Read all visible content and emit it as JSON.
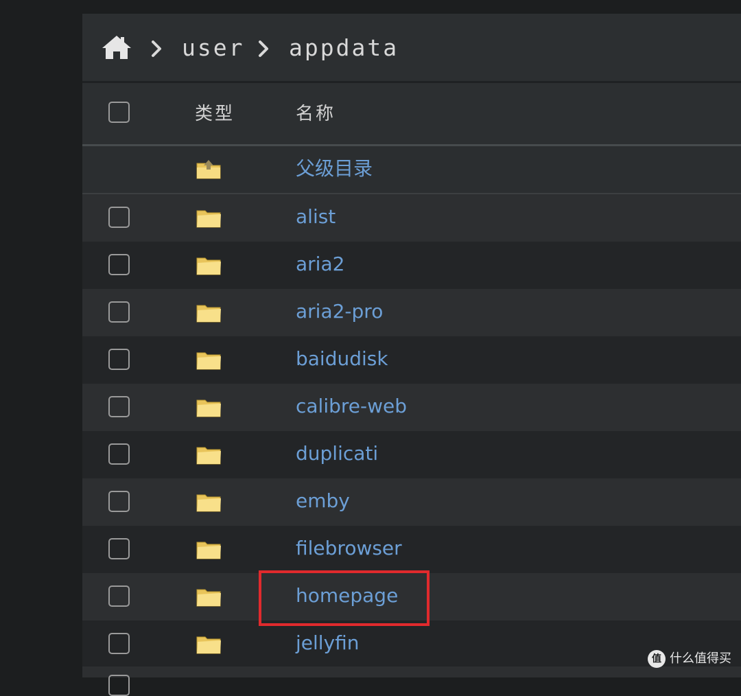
{
  "breadcrumb": {
    "home_icon": "home-icon",
    "segments": [
      "user",
      "appdata"
    ]
  },
  "table": {
    "headers": {
      "type": "类型",
      "name": "名称"
    },
    "parent_row": {
      "name": "父级目录",
      "icon": "folder-up-icon"
    },
    "rows": [
      {
        "name": "alist",
        "icon": "folder-icon"
      },
      {
        "name": "aria2",
        "icon": "folder-icon"
      },
      {
        "name": "aria2-pro",
        "icon": "folder-icon"
      },
      {
        "name": "baidudisk",
        "icon": "folder-icon"
      },
      {
        "name": "calibre-web",
        "icon": "folder-icon"
      },
      {
        "name": "duplicati",
        "icon": "folder-icon"
      },
      {
        "name": "emby",
        "icon": "folder-icon"
      },
      {
        "name": "filebrowser",
        "icon": "folder-icon"
      },
      {
        "name": "homepage",
        "icon": "folder-icon"
      },
      {
        "name": "jellyfin",
        "icon": "folder-icon"
      }
    ]
  },
  "highlight": {
    "target": "homepage",
    "color": "#e02a2d"
  },
  "watermark": {
    "logo_text": "值",
    "text": "什么值得买"
  },
  "colors": {
    "link": "#6c9fd6",
    "folder": "#f3d16b"
  }
}
